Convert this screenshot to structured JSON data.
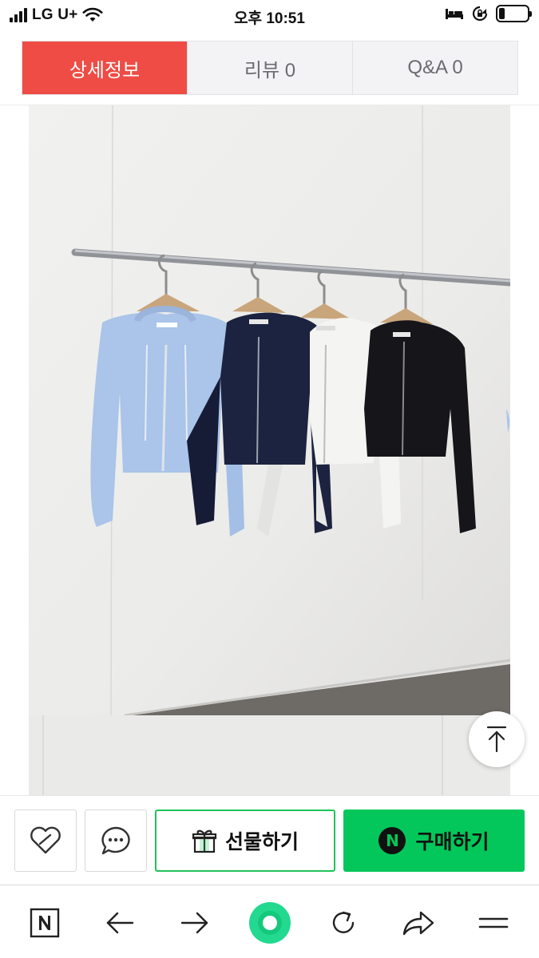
{
  "status_bar": {
    "carrier": "LG U+",
    "time": "오후 10:51",
    "battery_level": 0.2
  },
  "tabs": [
    {
      "label": "상세정보",
      "active": true
    },
    {
      "label": "리뷰  0",
      "active": false
    },
    {
      "label": "Q&A  0",
      "active": false
    }
  ],
  "action_bar": {
    "gift_label": "선물하기",
    "buy_label": "구매하기",
    "buy_badge": "N"
  },
  "icons": {
    "product_image_link": "link-icon",
    "scroll_top": "arrow-up-to-top-icon",
    "like": "heart-icon",
    "talk": "chat-bubble-icon",
    "gift": "gift-icon",
    "browser": [
      "naver-home-icon",
      "back-arrow-icon",
      "forward-arrow-icon",
      "green-dot-icon",
      "reload-icon",
      "share-icon",
      "menu-icon"
    ]
  },
  "colors": {
    "active_tab": "#ee4c45",
    "buy_button": "#03c75a",
    "gift_border": "#1fc35a",
    "hoodies": [
      "#aac4ea",
      "#1c2340",
      "#f4f4f2",
      "#15151a"
    ]
  }
}
